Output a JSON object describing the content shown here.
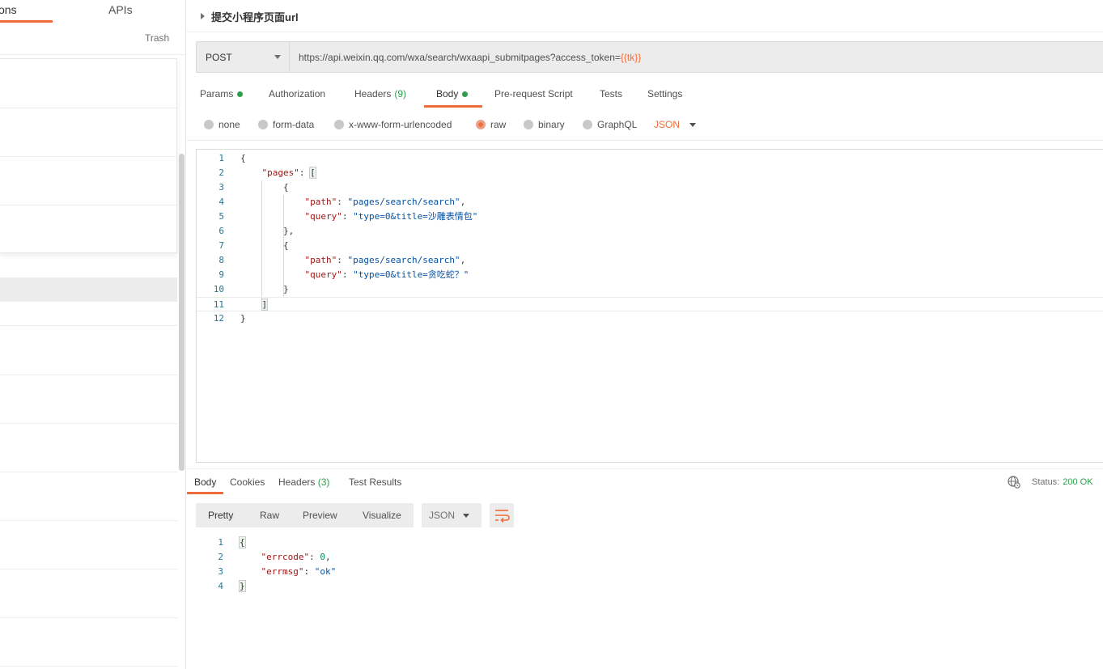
{
  "sidebar": {
    "tabs": [
      {
        "label": "ons"
      },
      {
        "label": "APIs"
      }
    ],
    "trash_label": "Trash"
  },
  "request": {
    "title": "提交小程序页面url",
    "method": "POST",
    "url_prefix": "https://api.weixin.qq.com/wxa/search/wxaapi_submitpages?access_token=",
    "url_variable": "{{tk}}",
    "tabs": [
      {
        "label": "Params",
        "dot": true
      },
      {
        "label": "Authorization"
      },
      {
        "label": "Headers",
        "count": "(9)"
      },
      {
        "label": "Body",
        "dot": true,
        "active": true
      },
      {
        "label": "Pre-request Script"
      },
      {
        "label": "Tests"
      },
      {
        "label": "Settings"
      }
    ],
    "body_options": [
      {
        "label": "none"
      },
      {
        "label": "form-data"
      },
      {
        "label": "x-www-form-urlencoded"
      },
      {
        "label": "raw",
        "selected": true
      },
      {
        "label": "binary"
      },
      {
        "label": "GraphQL"
      }
    ],
    "body_format": "JSON",
    "body_lines": [
      {
        "n": "1",
        "text": "{"
      },
      {
        "n": "2",
        "key": "\"pages\"",
        "rest": ": [",
        "indent": 1
      },
      {
        "n": "3",
        "text": "{",
        "indent": 2
      },
      {
        "n": "4",
        "key": "\"path\"",
        "str": "\"pages/search/search\"",
        "tail": ",",
        "indent": 3
      },
      {
        "n": "5",
        "key": "\"query\"",
        "str": "\"type=0&title=沙雕表情包\"",
        "tail": "",
        "indent": 3
      },
      {
        "n": "6",
        "text": "},",
        "indent": 2
      },
      {
        "n": "7",
        "text": "{",
        "indent": 2
      },
      {
        "n": "8",
        "key": "\"path\"",
        "str": "\"pages/search/search\"",
        "tail": ",",
        "indent": 3
      },
      {
        "n": "9",
        "key": "\"query\"",
        "str": "\"type=0&title=贪吃蛇？\"",
        "tail": "",
        "indent": 3
      },
      {
        "n": "10",
        "text": "}",
        "indent": 2
      },
      {
        "n": "11",
        "text": "]",
        "indent": 1
      },
      {
        "n": "12",
        "text": "}"
      }
    ]
  },
  "response": {
    "tabs": [
      {
        "label": "Body",
        "active": true
      },
      {
        "label": "Cookies"
      },
      {
        "label": "Headers",
        "count": "(3)"
      },
      {
        "label": "Test Results"
      }
    ],
    "status_label": "Status:",
    "status_value": "200 OK",
    "view_modes": [
      "Pretty",
      "Raw",
      "Preview",
      "Visualize"
    ],
    "format": "JSON",
    "body_lines": [
      {
        "n": "1",
        "text": "{"
      },
      {
        "n": "2",
        "key": "\"errcode\"",
        "num": "0",
        "tail": ","
      },
      {
        "n": "3",
        "key": "\"errmsg\"",
        "str": "\"ok\"",
        "tail": ""
      },
      {
        "n": "4",
        "text": "}"
      }
    ]
  },
  "colors": {
    "accent": "#f26b3a",
    "success": "#2e9d4e"
  },
  "icons": [
    "triangle-right-icon",
    "chevron-down-icon",
    "radio-icon",
    "globe-icon",
    "wrap-lines-icon"
  ]
}
